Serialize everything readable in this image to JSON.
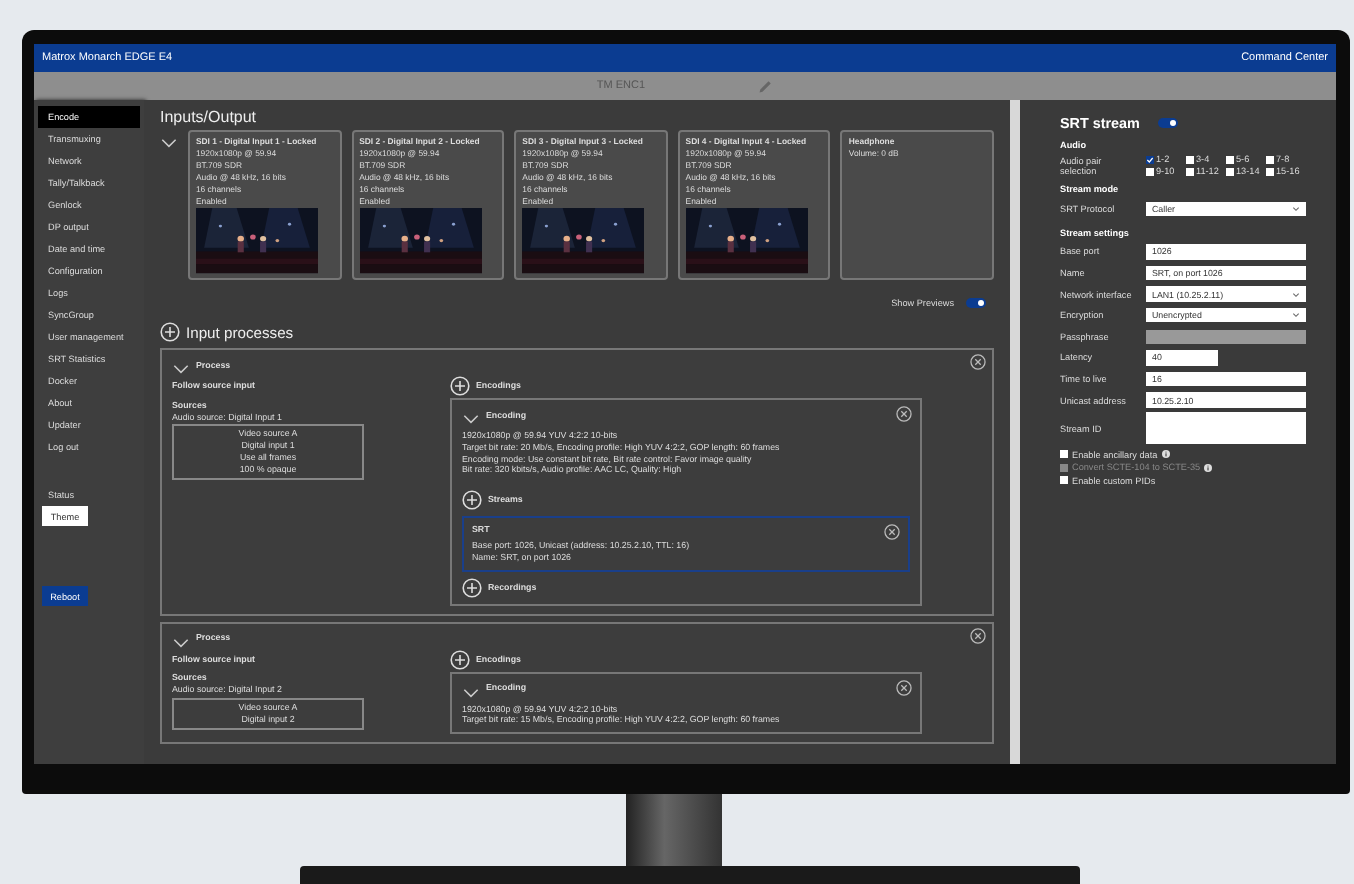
{
  "window": {
    "title": "Matrox Monarch EDGE E4",
    "right_link": "Command Center"
  },
  "device_bar": {
    "name": "TM ENC1"
  },
  "sidebar": {
    "items": [
      {
        "label": "Encode",
        "selected": true
      },
      {
        "label": "Transmuxing",
        "selected": false
      },
      {
        "label": "Network",
        "selected": false
      },
      {
        "label": "Tally/Talkback",
        "selected": false
      },
      {
        "label": "Genlock",
        "selected": false
      },
      {
        "label": "DP output",
        "selected": false
      },
      {
        "label": "Date and time",
        "selected": false
      },
      {
        "label": "Configuration",
        "selected": false
      },
      {
        "label": "Logs",
        "selected": false
      },
      {
        "label": "SyncGroup",
        "selected": false
      },
      {
        "label": "User management",
        "selected": false
      },
      {
        "label": "SRT Statistics",
        "selected": false
      },
      {
        "label": "Docker",
        "selected": false
      },
      {
        "label": "About",
        "selected": false
      },
      {
        "label": "Updater",
        "selected": false
      },
      {
        "label": "Log out",
        "selected": false
      }
    ],
    "status": "Status",
    "theme_button": "Theme",
    "reboot_button": "Reboot"
  },
  "inputs_output": {
    "title": "Inputs/Output",
    "cards": [
      {
        "kind": "input",
        "lines": [
          "SDI 1 - Digital Input 1 - Locked",
          "1920x1080p @ 59.94",
          "BT.709 SDR",
          "Audio @ 48 kHz, 16 bits",
          "16 channels",
          "Enabled"
        ]
      },
      {
        "kind": "input",
        "lines": [
          "SDI 2 - Digital Input 2 - Locked",
          "1920x1080p @ 59.94",
          "BT.709 SDR",
          "Audio @ 48 kHz, 16 bits",
          "16 channels",
          "Enabled"
        ]
      },
      {
        "kind": "input",
        "lines": [
          "SDI 3 - Digital Input 3 - Locked",
          "1920x1080p @ 59.94",
          "BT.709 SDR",
          "Audio @ 48 kHz, 16 bits",
          "16 channels",
          "Enabled"
        ]
      },
      {
        "kind": "input",
        "lines": [
          "SDI 4 - Digital Input 4 - Locked",
          "1920x1080p @ 59.94",
          "BT.709 SDR",
          "Audio @ 48 kHz, 16 bits",
          "16 channels",
          "Enabled"
        ]
      },
      {
        "kind": "output",
        "lines": [
          "Headphone",
          "Volume: 0 dB"
        ]
      }
    ],
    "show_previews": {
      "label": "Show Previews",
      "on": true
    }
  },
  "input_processes": {
    "title": "Input processes",
    "processes": [
      {
        "title": "Process",
        "follow": "Follow source input",
        "sources_heading": "Sources",
        "audio_source": "Audio source: Digital Input 1",
        "video_lines": [
          "Video source A",
          "Digital input 1",
          "Use all frames",
          "100 % opaque"
        ],
        "encodings_label": "Encodings",
        "encoding": {
          "title": "Encoding",
          "lines": [
            "1920x1080p @ 59.94 YUV 4:2:2 10-bits",
            "Target bit rate: 20 Mb/s, Encoding profile: High YUV 4:2:2, GOP length: 60 frames",
            "Encoding mode: Use constant bit rate, Bit rate control: Favor image quality",
            "Bit rate: 320 kbits/s, Audio profile: AAC LC, Quality: High"
          ]
        },
        "streams_label": "Streams",
        "stream": {
          "title": "SRT",
          "lines": [
            "Base port: 1026, Unicast (address: 10.25.2.10, TTL: 16)",
            "Name: SRT, on port 1026"
          ]
        },
        "recordings_label": "Recordings"
      },
      {
        "title": "Process",
        "follow": "Follow source input",
        "sources_heading": "Sources",
        "audio_source": "Audio source: Digital Input 2",
        "video_lines": [
          "Video source A",
          "Digital input 2"
        ],
        "encodings_label": "Encodings",
        "encoding": {
          "title": "Encoding",
          "lines": [
            "1920x1080p @ 59.94 YUV 4:2:2 10-bits",
            "Target bit rate: 15 Mb/s, Encoding profile: High YUV 4:2:2, GOP length: 60 frames"
          ]
        }
      }
    ]
  },
  "srt_panel": {
    "title": "SRT stream",
    "on": true,
    "audio": {
      "heading": "Audio",
      "label": "Audio pair selection",
      "pairs": [
        {
          "label": "1-2",
          "checked": true
        },
        {
          "label": "3-4",
          "checked": false
        },
        {
          "label": "5-6",
          "checked": false
        },
        {
          "label": "7-8",
          "checked": false
        },
        {
          "label": "9-10",
          "checked": false
        },
        {
          "label": "11-12",
          "checked": false
        },
        {
          "label": "13-14",
          "checked": false
        },
        {
          "label": "15-16",
          "checked": false
        }
      ]
    },
    "groups": [
      {
        "heading": "Stream mode",
        "fields": [
          {
            "kind": "select",
            "label": "SRT Protocol",
            "value": "Caller"
          }
        ]
      },
      {
        "heading": "Stream settings",
        "fields": [
          {
            "kind": "text",
            "label": "Base port",
            "value": "1026"
          },
          {
            "kind": "text",
            "label": "Name",
            "value": "SRT, on port 1026"
          },
          {
            "kind": "select",
            "label": "Network interface",
            "value": "LAN1 (10.25.2.11)"
          },
          {
            "kind": "select",
            "label": "Encryption",
            "value": "Unencrypted"
          },
          {
            "kind": "disabled",
            "label": "Passphrase"
          },
          {
            "kind": "short",
            "label": "Latency",
            "value": "40"
          },
          {
            "kind": "text",
            "label": "Time to live",
            "value": "16"
          },
          {
            "kind": "text",
            "label": "Unicast address",
            "value": "10.25.2.10"
          },
          {
            "kind": "textarea",
            "label": "Stream ID"
          }
        ]
      }
    ],
    "options": [
      {
        "label": "Enable ancillary data",
        "checked": false,
        "disabled": false,
        "info": true
      },
      {
        "label": "Convert SCTE-104 to SCTE-35",
        "checked": false,
        "disabled": true,
        "info": true
      },
      {
        "label": "Enable custom PIDs",
        "checked": false,
        "disabled": false,
        "info": false
      }
    ]
  }
}
